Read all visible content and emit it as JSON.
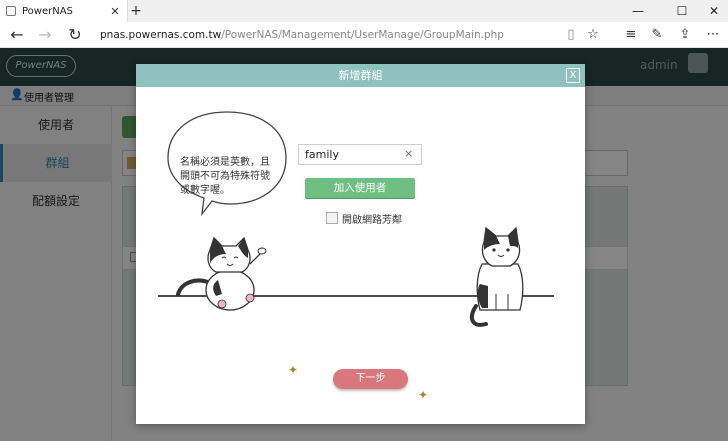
{
  "browser": {
    "tab_title": "PowerNAS",
    "tab_close": "✕",
    "new_tab": "+",
    "url_host": "pnas.powernas.com.tw",
    "url_path": "/PowerNAS/Management/UserManage/GroupMain.php",
    "icons": [
      "back-arrow-icon",
      "forward-arrow-icon",
      "refresh-icon",
      "reading-view-icon",
      "favorite-star-icon",
      "hub-icon",
      "notes-icon",
      "share-icon",
      "more-icon"
    ]
  },
  "app": {
    "logo_text": "PowerNAS",
    "user": "admin",
    "section_label": "使用者管理",
    "sidebar": {
      "items": [
        {
          "label": "使用者"
        },
        {
          "label": "群組"
        },
        {
          "label": "配額設定"
        }
      ]
    }
  },
  "modal": {
    "title": "新增群組",
    "close": "X",
    "hint": "名稱必須是英數，且開頭不可為特殊符號或數字喔。",
    "name_value": "family",
    "clear_icon": "×",
    "add_user_label": "加入使用者",
    "checkbox_label": "開啟網路芳鄰",
    "next_label": "下一步"
  },
  "colors": {
    "header_bg": "#2b4a45",
    "modal_head": "#8ec2bf",
    "add_button": "#6fbf83",
    "next_button": "#d9777c",
    "active_sidebar": "#2e8ab6"
  }
}
